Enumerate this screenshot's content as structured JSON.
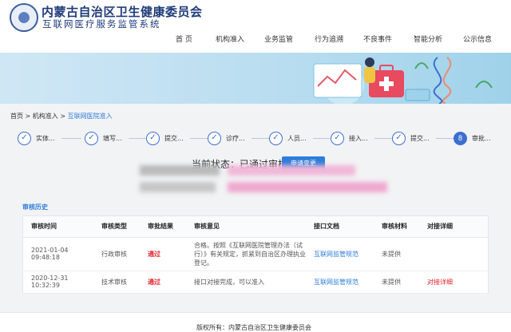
{
  "header": {
    "org_name": "内蒙古自治区卫生健康委员会",
    "org_sub": "互联网医疗服务监管系统",
    "nav": [
      "首 页",
      "机构准入",
      "业务监管",
      "行为追溯",
      "不良事件",
      "智能分析",
      "公示信息"
    ]
  },
  "breadcrumb": {
    "home": "首页",
    "sep1": " > ",
    "level1": "机构准入",
    "sep2": " > ",
    "current": "互联网医院准入"
  },
  "steps": [
    {
      "icon": "✓",
      "label": "实体..."
    },
    {
      "icon": "✓",
      "label": "填写..."
    },
    {
      "icon": "✓",
      "label": "提交..."
    },
    {
      "icon": "✓",
      "label": "诊疗..."
    },
    {
      "icon": "✓",
      "label": "人员..."
    },
    {
      "icon": "✓",
      "label": "接入..."
    },
    {
      "icon": "✓",
      "label": "提交..."
    },
    {
      "icon": "8",
      "label": "审批..."
    }
  ],
  "status": {
    "text": "当前状态：已通过审核",
    "apply_button": "申请变更"
  },
  "history": {
    "title": "审核历史",
    "headers": [
      "审核时间",
      "审核类型",
      "审批结果",
      "审核意见",
      "接口文档",
      "审核材料",
      "对接详细"
    ],
    "rows": [
      {
        "time": "2021-01-04 09:48:18",
        "type": "行政审核",
        "result": "通过",
        "opinion": "合格。按照《互联网医院管理办法（试行）》有关规定，抓紧到自治区办理执业登记。",
        "doc": "互联网监管规范",
        "material": "未提供",
        "detail": ""
      },
      {
        "time": "2020-12-31 10:32:39",
        "type": "技术审核",
        "result": "通过",
        "opinion": "接口对接完成，可以准入",
        "doc": "互联网监管规范",
        "material": "未提供",
        "detail": "对接详细"
      }
    ]
  },
  "footer": {
    "text": "版权所有：内蒙古自治区卫生健康委员会"
  },
  "colors": {
    "accent": "#2f7ddb",
    "brand": "#1f3b7a",
    "pass": "#e0232b"
  }
}
